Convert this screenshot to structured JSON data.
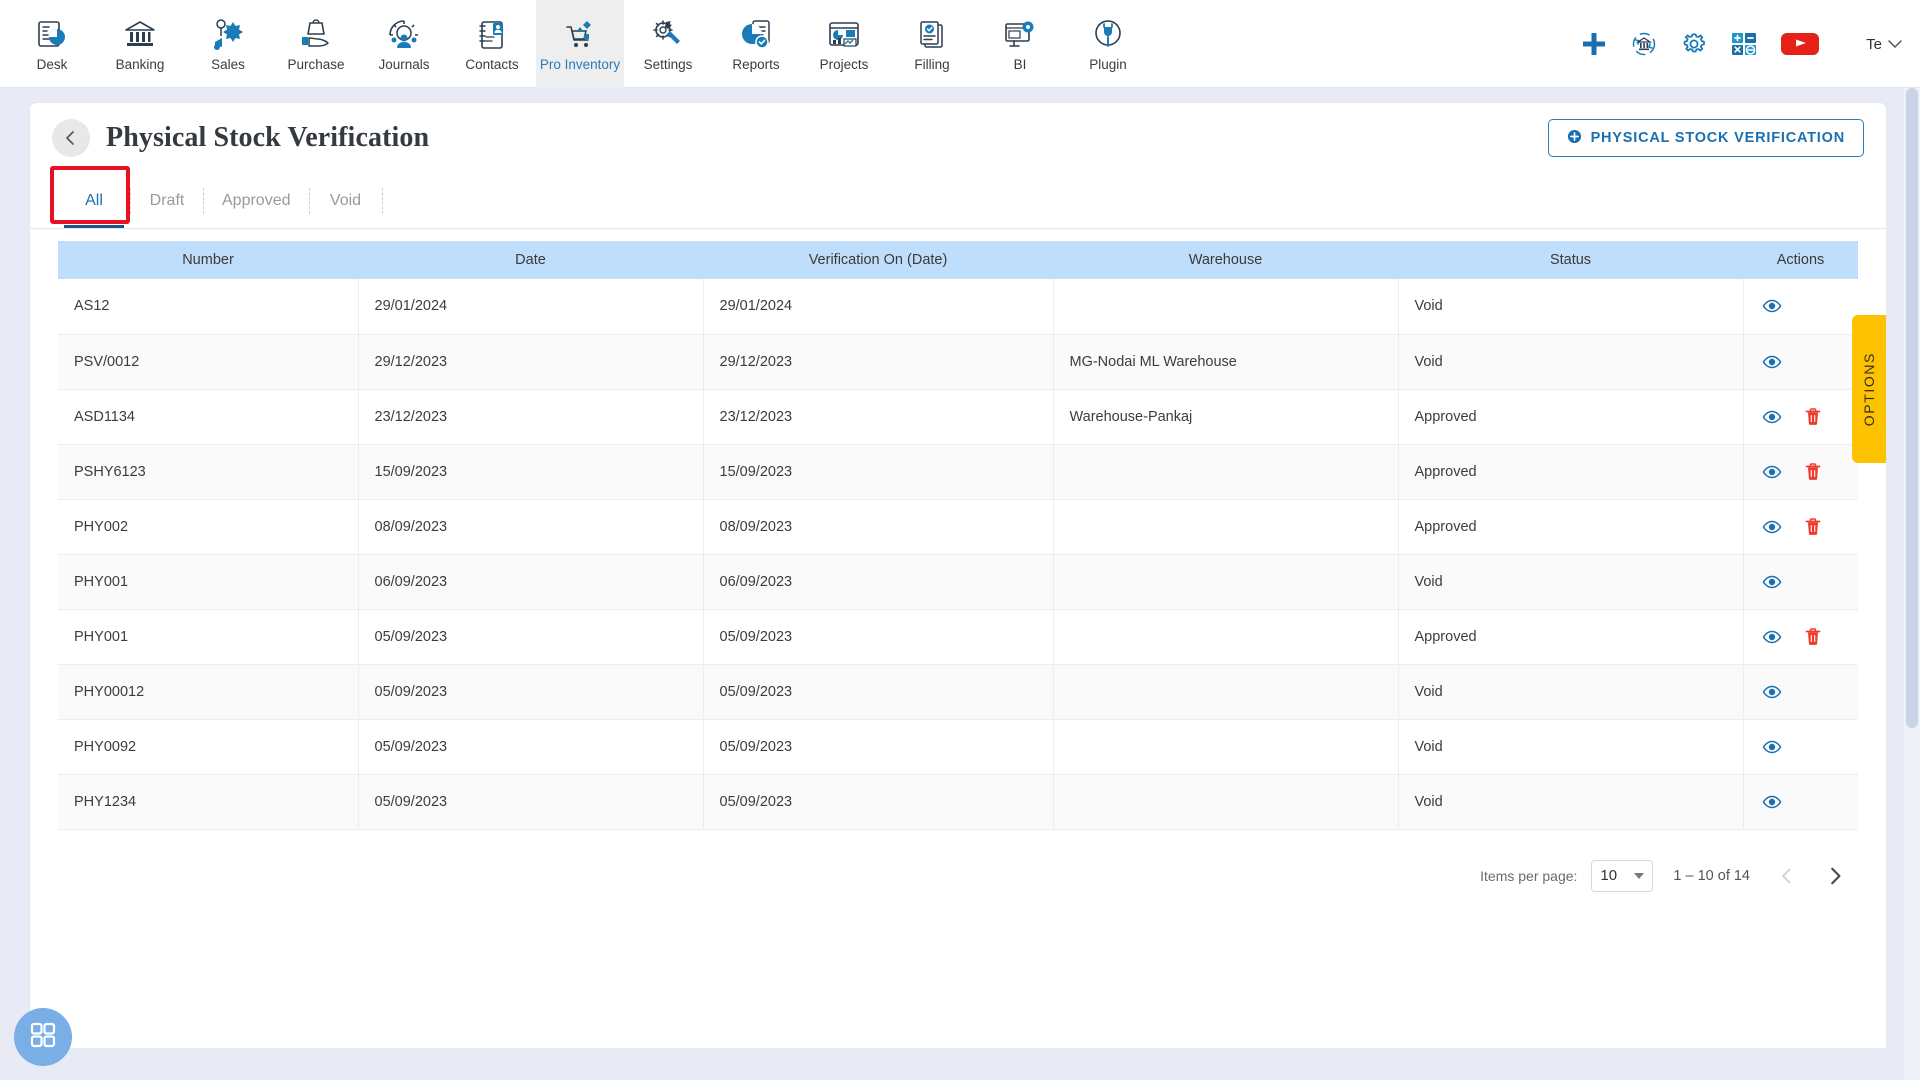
{
  "nav": {
    "items": [
      {
        "label": "Desk",
        "icon": "desk-dashboard-icon",
        "active": false
      },
      {
        "label": "Banking",
        "icon": "bank-icon",
        "active": false
      },
      {
        "label": "Sales",
        "icon": "sales-megaphone-icon",
        "active": false
      },
      {
        "label": "Purchase",
        "icon": "purchase-hand-bag-icon",
        "active": false
      },
      {
        "label": "Journals",
        "icon": "journals-gear-people-icon",
        "active": false
      },
      {
        "label": "Contacts",
        "icon": "contacts-book-icon",
        "active": false
      },
      {
        "label": "Pro Inventory",
        "icon": "inventory-cart-icon",
        "active": true
      },
      {
        "label": "Settings",
        "icon": "settings-gear-wrench-icon",
        "active": false
      },
      {
        "label": "Reports",
        "icon": "reports-pie-doc-icon",
        "active": false
      },
      {
        "label": "Projects",
        "icon": "projects-dashboard-icon",
        "active": false
      },
      {
        "label": "Filling",
        "icon": "filling-documents-icon",
        "active": false
      },
      {
        "label": "BI",
        "icon": "bi-monitor-gear-icon",
        "active": false
      },
      {
        "label": "Plugin",
        "icon": "plugin-plug-icon",
        "active": false
      }
    ],
    "right_icons": [
      {
        "name": "add-plus-icon",
        "color": "#1a6fb0"
      },
      {
        "name": "bank-sync-icon",
        "color": "#1a7bb9"
      },
      {
        "name": "settings-gear-icon",
        "color": "#1a7bb9"
      },
      {
        "name": "calculator-icon",
        "color": "#2196c9"
      },
      {
        "name": "youtube-icon",
        "color": "#e62117"
      }
    ],
    "user": {
      "name": "Te",
      "chevron": "⌄"
    }
  },
  "header": {
    "back_icon": "chevron-left-icon",
    "title": "Physical Stock Verification",
    "primary_button": {
      "label": "PHYSICAL STOCK VERIFICATION",
      "icon": "plus-circle-icon"
    }
  },
  "tabs": {
    "items": [
      {
        "label": "All",
        "active": true
      },
      {
        "label": "Draft",
        "active": false
      },
      {
        "label": "Approved",
        "active": false
      },
      {
        "label": "Void",
        "active": false
      }
    ],
    "highlight_color": "#e81123"
  },
  "table": {
    "columns": [
      "Number",
      "Date",
      "Verification On (Date)",
      "Warehouse",
      "Status",
      "Actions"
    ],
    "rows": [
      {
        "number": "AS12",
        "date": "29/01/2024",
        "verification_on": "29/01/2024",
        "warehouse": "",
        "status": "Void",
        "actions": [
          "view",
          ""
        ]
      },
      {
        "number": "PSV/0012",
        "date": "29/12/2023",
        "verification_on": "29/12/2023",
        "warehouse": "MG-Nodai ML Warehouse",
        "status": "Void",
        "actions": [
          "view",
          ""
        ]
      },
      {
        "number": "ASD1134",
        "date": "23/12/2023",
        "verification_on": "23/12/2023",
        "warehouse": "Warehouse-Pankaj",
        "status": "Approved",
        "actions": [
          "view",
          "delete"
        ]
      },
      {
        "number": "PSHY6123",
        "date": "15/09/2023",
        "verification_on": "15/09/2023",
        "warehouse": "",
        "status": "Approved",
        "actions": [
          "view",
          "delete"
        ]
      },
      {
        "number": "PHY002",
        "date": "08/09/2023",
        "verification_on": "08/09/2023",
        "warehouse": "",
        "status": "Approved",
        "actions": [
          "view",
          "delete"
        ]
      },
      {
        "number": "PHY001",
        "date": "06/09/2023",
        "verification_on": "06/09/2023",
        "warehouse": "",
        "status": "Void",
        "actions": [
          "view",
          ""
        ]
      },
      {
        "number": "PHY001",
        "date": "05/09/2023",
        "verification_on": "05/09/2023",
        "warehouse": "",
        "status": "Approved",
        "actions": [
          "view",
          "delete"
        ]
      },
      {
        "number": "PHY00012",
        "date": "05/09/2023",
        "verification_on": "05/09/2023",
        "warehouse": "",
        "status": "Void",
        "actions": [
          "view",
          ""
        ]
      },
      {
        "number": "PHY0092",
        "date": "05/09/2023",
        "verification_on": "05/09/2023",
        "warehouse": "",
        "status": "Void",
        "actions": [
          "view",
          ""
        ]
      },
      {
        "number": "PHY1234",
        "date": "05/09/2023",
        "verification_on": "05/09/2023",
        "warehouse": "",
        "status": "Void",
        "actions": [
          "view",
          ""
        ]
      }
    ]
  },
  "paginator": {
    "items_per_page_label": "Items per page:",
    "items_per_page_value": "10",
    "range_label": "1 – 10 of 14",
    "prev_icon": "chevron-left-icon",
    "next_icon": "chevron-right-icon"
  },
  "options_tab": {
    "label": "OPTIONS",
    "color": "#fdc300"
  },
  "fab": {
    "icon": "grid-apps-icon",
    "color": "#79aee6"
  }
}
